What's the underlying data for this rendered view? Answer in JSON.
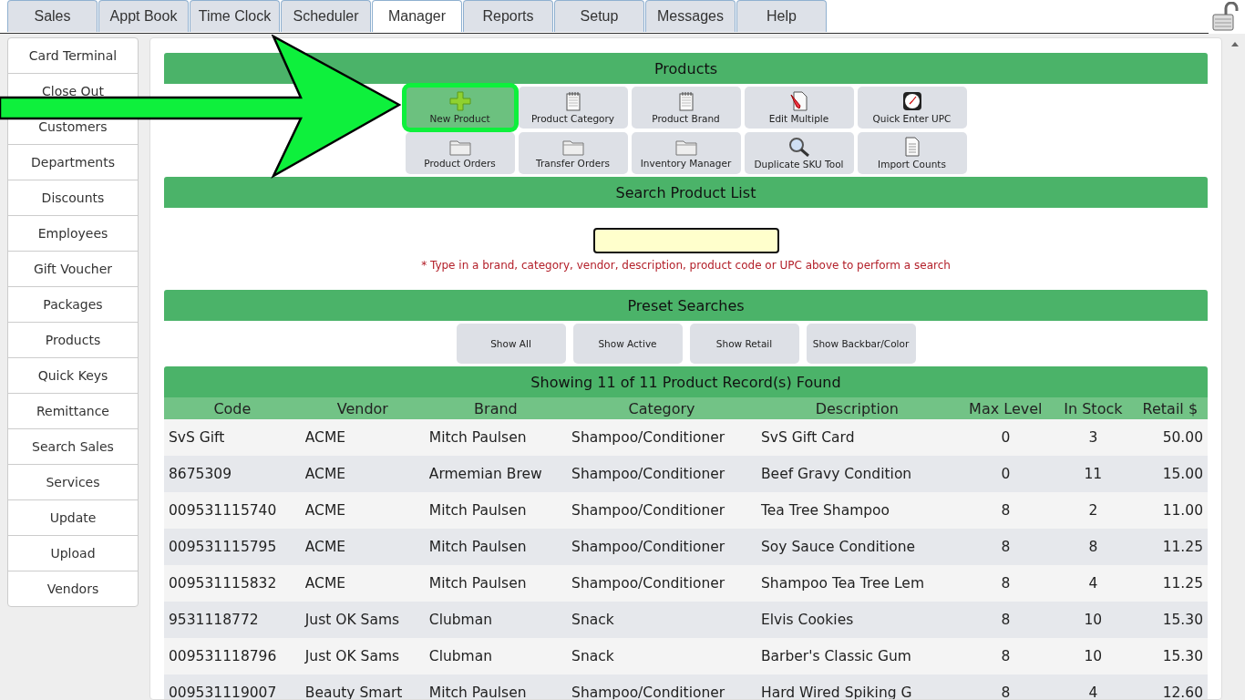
{
  "tabs": [
    {
      "label": "Sales",
      "selected": false
    },
    {
      "label": "Appt Book",
      "selected": false
    },
    {
      "label": "Time Clock",
      "selected": false
    },
    {
      "label": "Scheduler",
      "selected": false
    },
    {
      "label": "Manager",
      "selected": true
    },
    {
      "label": "Reports",
      "selected": false
    },
    {
      "label": "Setup",
      "selected": false
    },
    {
      "label": "Messages",
      "selected": false
    },
    {
      "label": "Help",
      "selected": false
    }
  ],
  "sidebar": {
    "items": [
      "Card Terminal",
      "Close Out",
      "Customers",
      "Departments",
      "Discounts",
      "Employees",
      "Gift Voucher",
      "Packages",
      "Products",
      "Quick Keys",
      "Remittance",
      "Search Sales",
      "Services",
      "Update",
      "Upload",
      "Vendors"
    ]
  },
  "products": {
    "title": "Products",
    "buttons": [
      {
        "label": "New Product",
        "kind": "plus",
        "highlighted": true
      },
      {
        "label": "Product Category",
        "kind": "notepad",
        "highlighted": false
      },
      {
        "label": "Product Brand",
        "kind": "notepad",
        "highlighted": false
      },
      {
        "label": "Edit Multiple",
        "kind": "pencil",
        "highlighted": false
      },
      {
        "label": "Quick Enter UPC",
        "kind": "clock",
        "highlighted": false
      },
      {
        "label": "Product Orders",
        "kind": "folder",
        "highlighted": false
      },
      {
        "label": "Transfer Orders",
        "kind": "folder",
        "highlighted": false
      },
      {
        "label": "Inventory Manager",
        "kind": "folder",
        "highlighted": false
      },
      {
        "label": "Duplicate SKU Tool",
        "kind": "magnifier",
        "highlighted": false
      },
      {
        "label": "Import Counts",
        "kind": "document",
        "highlighted": false
      }
    ]
  },
  "search": {
    "title": "Search Product List",
    "hint": "* Type in a brand, category, vendor, description, product code or UPC above to perform a search"
  },
  "preset_searches": {
    "title": "Preset Searches",
    "buttons": [
      "Show All",
      "Show Active",
      "Show Retail",
      "Show Backbar/Color"
    ]
  },
  "table": {
    "title": "Showing 11 of 11 Product Record(s) Found",
    "columns": [
      "Code",
      "Vendor",
      "Brand",
      "Category",
      "Description",
      "Max Level",
      "In Stock",
      "Retail $"
    ],
    "rows": [
      [
        "SvS Gift",
        "ACME",
        "Mitch Paulsen",
        "Shampoo/Conditioner",
        "SvS Gift Card",
        "0",
        "3",
        "50.00"
      ],
      [
        "8675309",
        "ACME",
        "Armemian Brew",
        "Shampoo/Conditioner",
        "Beef Gravy Condition",
        "0",
        "11",
        "15.00"
      ],
      [
        "009531115740",
        "ACME",
        "Mitch Paulsen",
        "Shampoo/Conditioner",
        "Tea Tree Shampoo",
        "8",
        "2",
        "11.00"
      ],
      [
        "009531115795",
        "ACME",
        "Mitch Paulsen",
        "Shampoo/Conditioner",
        "Soy Sauce Conditione",
        "8",
        "8",
        "11.25"
      ],
      [
        "009531115832",
        "ACME",
        "Mitch Paulsen",
        "Shampoo/Conditioner",
        "Shampoo Tea Tree Lem",
        "8",
        "4",
        "11.25"
      ],
      [
        "9531118772",
        "Just OK Sams",
        "Clubman",
        "Snack",
        "Elvis Cookies",
        "8",
        "10",
        "15.30"
      ],
      [
        "009531118796",
        "Just OK Sams",
        "Clubman",
        "Snack",
        "Barber's Classic Gum",
        "8",
        "10",
        "15.30"
      ],
      [
        "009531119007",
        "Beauty Smart",
        "Mitch Paulsen",
        "Shampoo/Conditioner",
        "Hard Wired Spiking G",
        "8",
        "4",
        "12.60"
      ]
    ]
  }
}
